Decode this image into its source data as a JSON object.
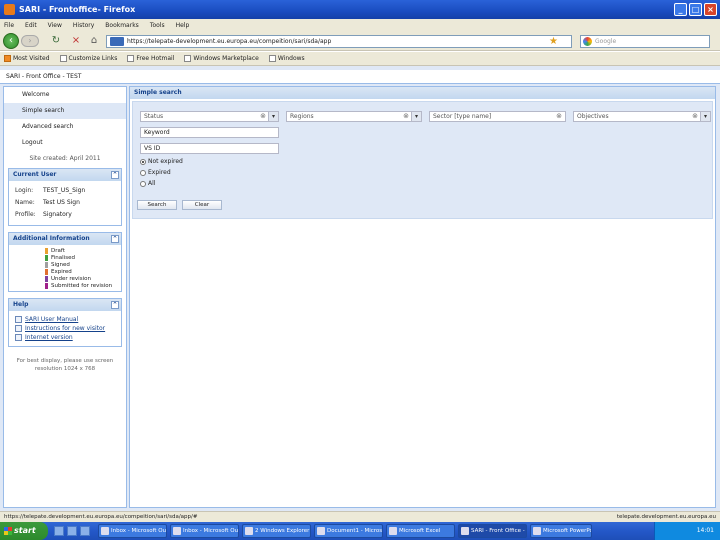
{
  "window": {
    "title": "SARI - Frontoffice- Firefox"
  },
  "menu": [
    "File",
    "Edit",
    "View",
    "History",
    "Bookmarks",
    "Tools",
    "Help"
  ],
  "nav": {
    "url": "https://telepate-development.eu.europa.eu/compeition/sari/sda/app",
    "search_placeholder": "Google"
  },
  "bookmarks": [
    "Most Visited",
    "Customize Links",
    "Free Hotmail",
    "Windows Marketplace",
    "Windows"
  ],
  "app": {
    "title": "SARI - Front Office - TEST"
  },
  "sidebar": {
    "nav": [
      "Welcome",
      "Simple search",
      "Advanced search",
      "Logout"
    ],
    "updated": "Site created: April 2011",
    "current_user": {
      "title": "Current User",
      "rows": [
        {
          "k": "Login:",
          "v": "TEST_US_Sign"
        },
        {
          "k": "Name:",
          "v": "Test US Sign"
        },
        {
          "k": "Profile:",
          "v": "Signatory"
        }
      ]
    },
    "additional": {
      "title": "Additional Information",
      "legend": [
        {
          "label": "Draft",
          "color": "#e8a030"
        },
        {
          "label": "Finalised",
          "color": "#40a040"
        },
        {
          "label": "Signed",
          "color": "#a0a0a0"
        },
        {
          "label": "Expired",
          "color": "#e07030"
        },
        {
          "label": "Under revision",
          "color": "#8040a0"
        },
        {
          "label": "Submitted for revision",
          "color": "#a0208a"
        }
      ]
    },
    "help": {
      "title": "Help",
      "items": [
        "SARI User Manual",
        "Instructions for new visitor",
        "Internet version"
      ]
    },
    "footnote": "For best display, please use screen resolution 1024 x 768"
  },
  "search": {
    "title": "Simple search",
    "combos": [
      "Status",
      "Regions",
      "Sector [type name]",
      "Objectives"
    ],
    "text_fields": [
      "Keyword",
      "VS ID"
    ],
    "radios": [
      {
        "label": "Not expired",
        "checked": true
      },
      {
        "label": "Expired",
        "checked": false
      },
      {
        "label": "All",
        "checked": false
      }
    ],
    "buttons": [
      "Search",
      "Clear"
    ]
  },
  "status": {
    "left": "https://telepate.development.eu.europa.eu/compeition/sari/sda/app/#",
    "right": "telepate.development.eu.europa.eu"
  },
  "taskbar": {
    "start": "start",
    "tasks": [
      "Inbox - Microsoft Out...",
      "Inbox - Microsoft Out...",
      "2 Windows Explorer",
      "Document1 - Microso...",
      "Microsoft Excel",
      "SARI - Front Office - F...",
      "Microsoft PowerPoint..."
    ],
    "clock": "14:01"
  }
}
